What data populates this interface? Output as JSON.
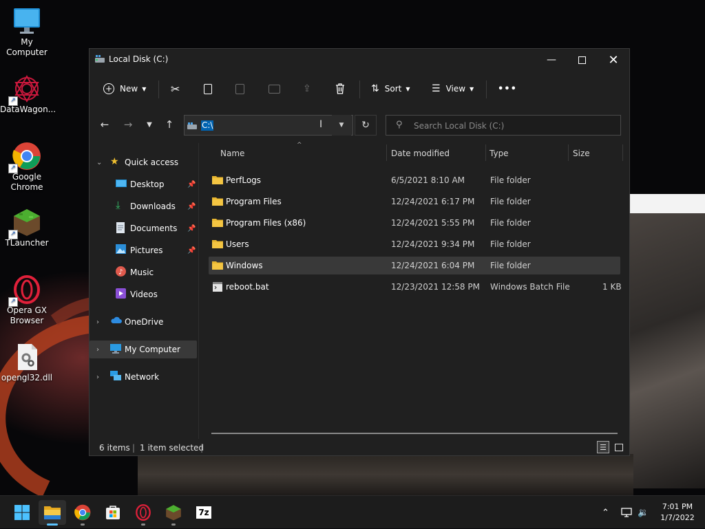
{
  "desktop": {
    "icons": [
      {
        "label": "My Computer",
        "icon": "monitor-icon"
      },
      {
        "label": "DataWagon...",
        "icon": "datawagon-icon"
      },
      {
        "label": "Google Chrome",
        "icon": "chrome-icon"
      },
      {
        "label": "TLauncher",
        "icon": "tlauncher-icon"
      },
      {
        "label": "Opera GX Browser",
        "icon": "opera-gx-icon"
      },
      {
        "label": "opengl32.dll",
        "icon": "dll-file-icon"
      }
    ]
  },
  "window": {
    "title": "Local Disk (C:)",
    "toolbar": {
      "new_label": "New",
      "sort_label": "Sort",
      "view_label": "View",
      "more_label": "•••"
    },
    "nav": {
      "address": "C:\\",
      "search_placeholder": "Search Local Disk (C:)"
    },
    "sidebar": {
      "quick_access": "Quick access",
      "items": [
        {
          "label": "Desktop",
          "pinned": true
        },
        {
          "label": "Downloads",
          "pinned": true
        },
        {
          "label": "Documents",
          "pinned": true
        },
        {
          "label": "Pictures",
          "pinned": true
        },
        {
          "label": "Music",
          "pinned": false
        },
        {
          "label": "Videos",
          "pinned": false
        }
      ],
      "onedrive": "OneDrive",
      "my_computer": "My Computer",
      "network": "Network"
    },
    "columns": {
      "name": "Name",
      "date": "Date modified",
      "type": "Type",
      "size": "Size"
    },
    "files": [
      {
        "name": "PerfLogs",
        "date": "6/5/2021 8:10 AM",
        "type": "File folder",
        "size": "",
        "kind": "folder",
        "selected": false
      },
      {
        "name": "Program Files",
        "date": "12/24/2021 6:17 PM",
        "type": "File folder",
        "size": "",
        "kind": "folder",
        "selected": false
      },
      {
        "name": "Program Files (x86)",
        "date": "12/24/2021 5:55 PM",
        "type": "File folder",
        "size": "",
        "kind": "folder",
        "selected": false
      },
      {
        "name": "Users",
        "date": "12/24/2021 9:34 PM",
        "type": "File folder",
        "size": "",
        "kind": "folder",
        "selected": false
      },
      {
        "name": "Windows",
        "date": "12/24/2021 6:04 PM",
        "type": "File folder",
        "size": "",
        "kind": "folder",
        "selected": true
      },
      {
        "name": "reboot.bat",
        "date": "12/23/2021 12:58 PM",
        "type": "Windows Batch File",
        "size": "1 KB",
        "kind": "bat",
        "selected": false
      }
    ],
    "status": {
      "count": "6 items",
      "selection": "1 item selected"
    }
  },
  "taskbar": {
    "clock_time": "7:01 PM",
    "clock_date": "1/7/2022",
    "apps": [
      "start-icon",
      "file-explorer-icon",
      "chrome-icon",
      "store-icon",
      "opera-gx-icon",
      "tlauncher-icon",
      "7zip-icon"
    ],
    "seven_zip_label": "7z"
  },
  "colors": {
    "selection_blue": "#0063b1",
    "folder_yellow": "#f4c542",
    "window_bg": "#202020",
    "accent": "#5cc4ff"
  }
}
